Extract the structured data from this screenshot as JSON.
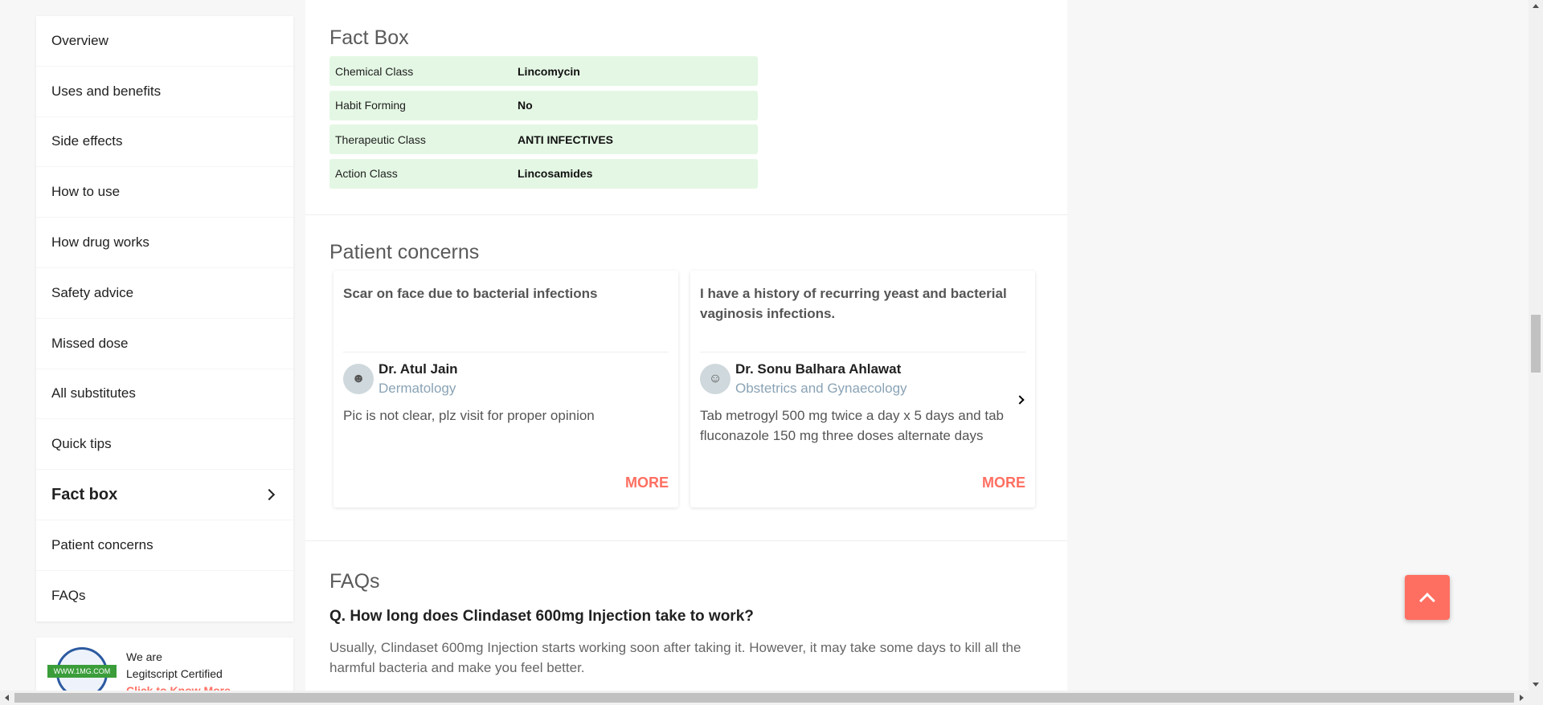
{
  "sidebar": {
    "items": [
      {
        "label": "Overview"
      },
      {
        "label": "Uses and benefits"
      },
      {
        "label": "Side effects"
      },
      {
        "label": "How to use"
      },
      {
        "label": "How drug works"
      },
      {
        "label": "Safety advice"
      },
      {
        "label": "Missed dose"
      },
      {
        "label": "All substitutes"
      },
      {
        "label": "Quick tips"
      },
      {
        "label": "Fact box",
        "active": true
      },
      {
        "label": "Patient concerns"
      },
      {
        "label": "FAQs"
      }
    ],
    "legit": {
      "line1": "We are",
      "line2": "Legitscript Certified",
      "link": "Click to Know More",
      "seal_text": "WWW.1MG.COM"
    }
  },
  "factbox": {
    "title": "Fact Box",
    "rows": [
      {
        "key": "Chemical Class",
        "value": "Lincomycin"
      },
      {
        "key": "Habit Forming",
        "value": "No"
      },
      {
        "key": "Therapeutic Class",
        "value": "ANTI INFECTIVES"
      },
      {
        "key": "Action Class",
        "value": "Lincosamides"
      }
    ]
  },
  "concerns": {
    "title": "Patient concerns",
    "cards": [
      {
        "question": "Scar on face due to bacterial infections",
        "doctor": "Dr. Atul Jain",
        "specialty": "Dermatology",
        "answer": "Pic is not clear, plz visit for proper opinion",
        "more": "MORE"
      },
      {
        "question": "I have a history of recurring yeast and bacterial vaginosis infections.",
        "doctor": "Dr. Sonu Balhara Ahlawat",
        "specialty": "Obstetrics and Gynaecology",
        "answer": "Tab metrogyl 500 mg twice a day x 5 days and tab fluconazole 150 mg three doses alternate days",
        "more": "MORE"
      }
    ]
  },
  "faqs": {
    "title": "FAQs",
    "items": [
      {
        "question": "Q. How long does Clindaset 600mg Injection take to work?",
        "answer": "Usually, Clindaset 600mg Injection starts working soon after taking it. However, it may take some days to kill all the harmful bacteria and make you feel better."
      }
    ]
  },
  "colors": {
    "accent": "#ff6f61",
    "fact_bg": "#e4f7e4",
    "specialty": "#8aa3b5"
  }
}
